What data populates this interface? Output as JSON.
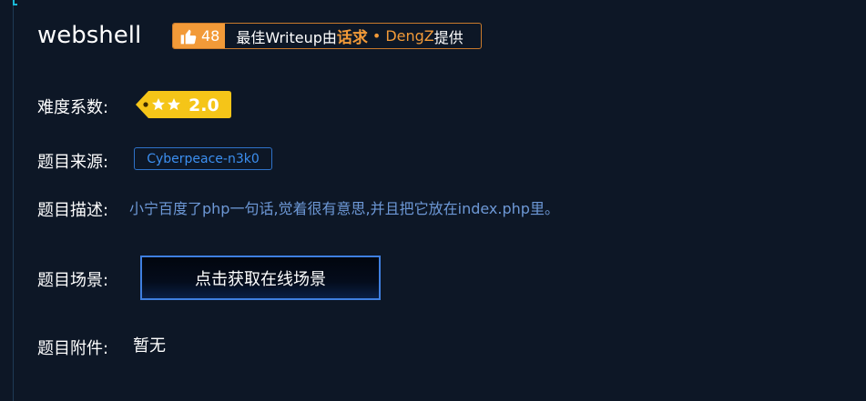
{
  "challenge": {
    "title": "webshell"
  },
  "writeup_badge": {
    "like_count": "48",
    "text_prefix": "最佳Writeup由",
    "team": "话求",
    "separator": "•",
    "author": "DengZ",
    "text_suffix": "提供",
    "accent_color": "#f29a38"
  },
  "difficulty": {
    "label": "难度系数:",
    "stars": 2,
    "value": "2.0",
    "tag_color": "#f5c518"
  },
  "source": {
    "label": "题目来源:",
    "value": "Cyberpeace-n3k0"
  },
  "description": {
    "label": "题目描述:",
    "value": "小宁百度了php一句话,觉着很有意思,并且把它放在index.php里。"
  },
  "scene": {
    "label": "题目场景:",
    "button_label": "点击获取在线场景"
  },
  "attachment": {
    "label": "题目附件:",
    "value": "暂无"
  },
  "icons": {
    "like": "thumbs-up-icon",
    "star": "star-icon"
  }
}
